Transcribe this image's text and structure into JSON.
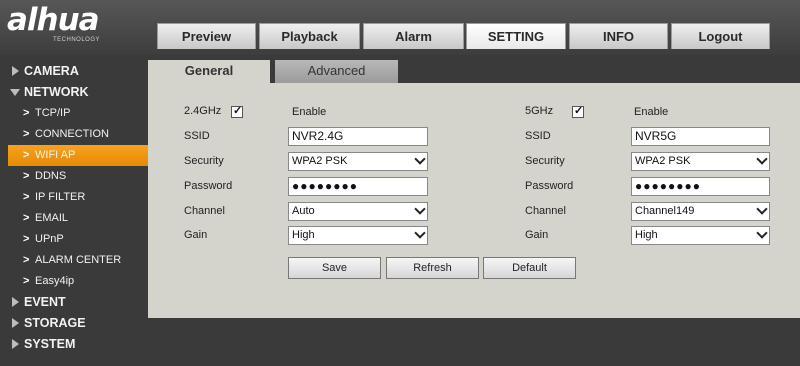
{
  "brand": {
    "name": "alhua",
    "tagline": "TECHNOLOGY"
  },
  "tabs": [
    {
      "label": "Preview"
    },
    {
      "label": "Playback"
    },
    {
      "label": "Alarm"
    },
    {
      "label": "SETTING"
    },
    {
      "label": "INFO"
    },
    {
      "label": "Logout"
    }
  ],
  "sidebar": {
    "sections": [
      {
        "label": "CAMERA"
      },
      {
        "label": "NETWORK"
      },
      {
        "label": "EVENT"
      },
      {
        "label": "STORAGE"
      },
      {
        "label": "SYSTEM"
      }
    ],
    "network_items": [
      {
        "label": "TCP/IP"
      },
      {
        "label": "CONNECTION"
      },
      {
        "label": "WIFI AP"
      },
      {
        "label": "DDNS"
      },
      {
        "label": "IP FILTER"
      },
      {
        "label": "EMAIL"
      },
      {
        "label": "UPnP"
      },
      {
        "label": "ALARM CENTER"
      },
      {
        "label": "Easy4ip"
      }
    ],
    "active_item": "WIFI AP"
  },
  "content_tabs": {
    "general": "General",
    "advanced": "Advanced"
  },
  "band_24": {
    "band_label": "2.4GHz",
    "enabled": true,
    "enable_label": "Enable",
    "ssid_label": "SSID",
    "ssid_value": "NVR2.4G",
    "security_label": "Security",
    "security_value": "WPA2 PSK",
    "password_label": "Password",
    "password_value": "●●●●●●●●",
    "channel_label": "Channel",
    "channel_value": "Auto",
    "gain_label": "Gain",
    "gain_value": "High"
  },
  "band_5": {
    "band_label": "5GHz",
    "enabled": true,
    "enable_label": "Enable",
    "ssid_label": "SSID",
    "ssid_value": "NVR5G",
    "security_label": "Security",
    "security_value": "WPA2 PSK",
    "password_label": "Password",
    "password_value": "●●●●●●●●",
    "channel_label": "Channel",
    "channel_value": "Channel149",
    "gain_label": "Gain",
    "gain_value": "High"
  },
  "buttons": {
    "save": "Save",
    "refresh": "Refresh",
    "default": "Default"
  },
  "checkmark": "✓",
  "colors": {
    "active_orange": "#f0961a",
    "panel_bg": "#d4d4cc",
    "chrome_bg": "#3a3a3a"
  },
  "icons": {
    "expand": "triangle-right-icon",
    "collapse": "triangle-down-icon",
    "sub": "chevron-right-icon",
    "dropdown": "chevron-down-icon"
  }
}
